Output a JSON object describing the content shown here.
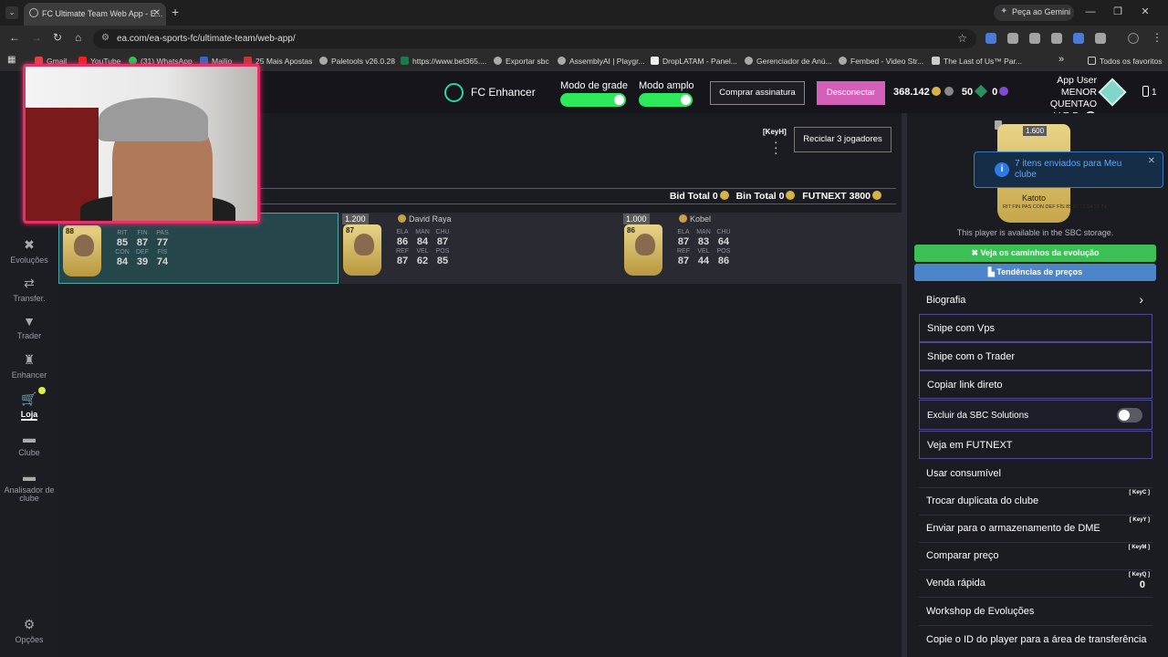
{
  "browser": {
    "tab_title": "FC Ultimate Team Web App - E...",
    "tab_close": "✕",
    "new_tab": "+",
    "gemini_label": "Peça ao Gemini",
    "url": "ea.com/ea-sports-fc/ultimate-team/web-app/",
    "bookmarks": [
      "Gmail",
      "YouTube",
      "(31) WhatsApp",
      "Mailio",
      "25 Mais Apostas",
      "Paletools v26.0.28",
      "https://www.bet365....",
      "Exportar sbc",
      "AssemblyAI | Playgr...",
      "DropLATAM - Panel...",
      "Gerenciador de Anú...",
      "Fembed - Video Str...",
      "The Last of Us™ Par..."
    ],
    "bookmarks_more": "»",
    "all_favorites": "Todos os favoritos"
  },
  "sidebar": {
    "items": [
      {
        "label": "Evoluções",
        "icon": "evolutions-icon"
      },
      {
        "label": "Transfer.",
        "icon": "transfer-icon"
      },
      {
        "label": "Trader",
        "icon": "trader-icon"
      },
      {
        "label": "Enhancer",
        "icon": "enhancer-icon"
      },
      {
        "label": "Loja",
        "icon": "store-icon"
      },
      {
        "label": "Clube",
        "icon": "club-icon"
      },
      {
        "label": "Analisador de clube",
        "icon": "analyzer-icon"
      }
    ],
    "options_label": "Opções"
  },
  "topbar": {
    "title": "FC Enhancer",
    "grid_mode_label": "Modo de grade",
    "wide_mode_label": "Modo amplo",
    "subscribe_label": "Comprar assinatura",
    "disconnect_label": "Desconectar",
    "coins": "368.142",
    "points": "50",
    "fc_points": "0",
    "user_name": "App User",
    "club_name": "MENOR QUENTAO",
    "ved": "V-E-D:",
    "devices": "1"
  },
  "main": {
    "key_hint": "[KeyH]",
    "recycle_label": "Reciclar 3 jogadores",
    "bid_total": "Bid Total 0",
    "bin_total": "Bin Total 0",
    "futnext": "FUTNEXT 3800",
    "players": [
      {
        "name": "",
        "rating": "88",
        "price": "",
        "stat_labels": [
          "RIT",
          "FIN",
          "PAS",
          "CON",
          "DEF",
          "FÍS"
        ],
        "stats": [
          "85",
          "87",
          "77",
          "84",
          "39",
          "74"
        ]
      },
      {
        "name": "David Raya",
        "rating": "87",
        "price": "1.200",
        "stat_labels": [
          "ELA",
          "MAN",
          "CHU",
          "REF",
          "VEL",
          "POS"
        ],
        "stats": [
          "86",
          "84",
          "87",
          "87",
          "62",
          "85"
        ]
      },
      {
        "name": "Kobel",
        "rating": "86",
        "price": "1.000",
        "stat_labels": [
          "ELA",
          "MAN",
          "CHU",
          "REF",
          "VEL",
          "POS"
        ],
        "stats": [
          "87",
          "83",
          "64",
          "87",
          "44",
          "86"
        ]
      }
    ]
  },
  "detail": {
    "card_price": "1.600",
    "card_name": "Katoto",
    "card_stats": "RIT FIN PAS CON DEF FÍS 85 87 77 84 39 74",
    "toast_text": "7 itens enviados para Meu clube",
    "toast_close": "✕",
    "storage_text": "This player is available in the SBC storage.",
    "evo_paths_label": "Veja os caminhos da evolução",
    "price_trends_label": "Tendências de preços",
    "menu": {
      "bio": "Biografia",
      "snipe_vps": "Snipe com Vps",
      "snipe_trader": "Snipe com o Trader",
      "copy_link": "Copiar link direto",
      "exclude_sbc": "Excluir da SBC Solutions",
      "view_futnext": "Veja em FUTNEXT",
      "use_consumable": "Usar consumível",
      "swap_duplicate": "Trocar duplicata do clube",
      "swap_duplicate_key": "[ KeyC ]",
      "send_storage": "Enviar para o armazenamento de DME",
      "send_storage_key": "[ KeyY ]",
      "compare_price": "Comparar preço",
      "compare_price_key": "[ KeyM ]",
      "quick_sell": "Venda rápida",
      "quick_sell_key": "[ KeyQ ]",
      "quick_sell_value": "0",
      "evo_workshop": "Workshop de Evoluções",
      "copy_id": "Copie o ID do player para a área de transferência"
    }
  }
}
